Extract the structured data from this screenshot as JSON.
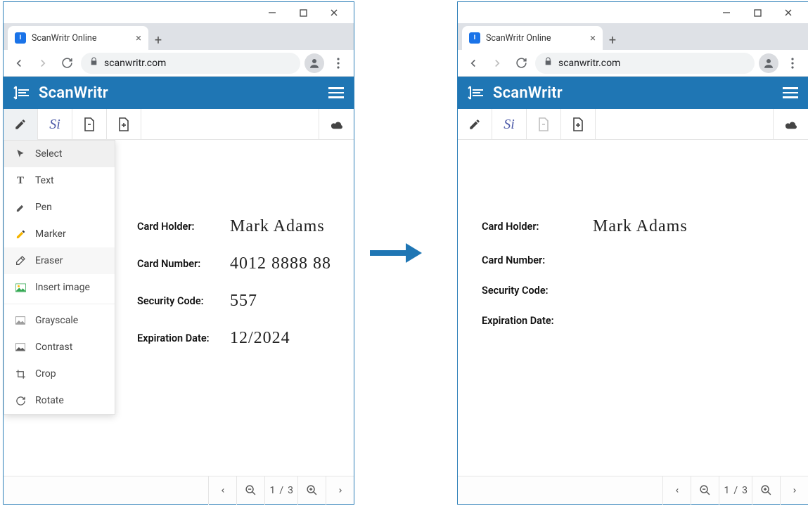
{
  "browser": {
    "tab_title": "ScanWritr Online",
    "url": "scanwritr.com"
  },
  "app": {
    "brand": "ScanWritr"
  },
  "menu": {
    "select": "Select",
    "text": "Text",
    "pen": "Pen",
    "marker": "Marker",
    "eraser": "Eraser",
    "insert_image": "Insert image",
    "grayscale": "Grayscale",
    "contrast": "Contrast",
    "crop": "Crop",
    "rotate": "Rotate"
  },
  "doc_before": {
    "labels": {
      "card_holder": "Card Holder:",
      "card_number": "Card Number:",
      "security_code": "Security Code:",
      "expiration_date": "Expiration Date:"
    },
    "values": {
      "card_holder": "Mark Adams",
      "card_number": "4012 8888 88",
      "security_code": "557",
      "expiration_date": "12/2024"
    }
  },
  "doc_after": {
    "labels": {
      "card_holder": "Card Holder:",
      "card_number": "Card Number:",
      "security_code": "Security Code:",
      "expiration_date": "Expiration Date:"
    },
    "values": {
      "card_holder": "Mark Adams",
      "card_number": "",
      "security_code": "",
      "expiration_date": ""
    }
  },
  "pager": {
    "current": "1",
    "sep": "/",
    "total": "3"
  }
}
